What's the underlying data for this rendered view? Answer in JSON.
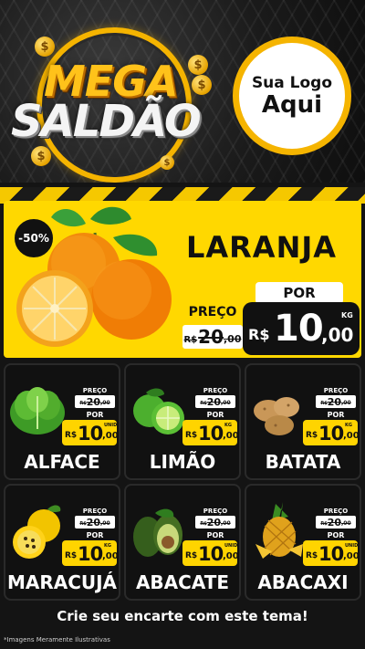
{
  "header": {
    "title_line1": "MEGA",
    "title_line2": "SALDÃO",
    "coin_symbol": "$",
    "logo_line1": "Sua Logo",
    "logo_line2": "Aqui",
    "accent_color": "#f5b400"
  },
  "featured": {
    "discount": "-50%",
    "name": "LARANJA",
    "preco_label": "PREÇO",
    "old_price": {
      "currency": "R$",
      "integer": "20",
      "cents": ",00"
    },
    "por_label": "POR",
    "new_price": {
      "currency": "R$",
      "integer": "10",
      "cents": ",00",
      "unit": "KG"
    },
    "icon": "orange-fruit-icon",
    "background_color": "#ffd800"
  },
  "products": [
    {
      "name": "ALFACE",
      "icon": "lettuce-icon",
      "preco_label": "PREÇO",
      "old_price": {
        "currency": "R$",
        "integer": "20",
        "cents": ",00"
      },
      "por_label": "POR",
      "new_price": {
        "currency": "R$",
        "integer": "10",
        "cents": ",00",
        "unit": "UNID"
      }
    },
    {
      "name": "LIMÃO",
      "icon": "lime-icon",
      "preco_label": "PREÇO",
      "old_price": {
        "currency": "R$",
        "integer": "20",
        "cents": ",00"
      },
      "por_label": "POR",
      "new_price": {
        "currency": "R$",
        "integer": "10",
        "cents": ",00",
        "unit": "KG"
      }
    },
    {
      "name": "BATATA",
      "icon": "potato-icon",
      "preco_label": "PREÇO",
      "old_price": {
        "currency": "R$",
        "integer": "20",
        "cents": ",00"
      },
      "por_label": "POR",
      "new_price": {
        "currency": "R$",
        "integer": "10",
        "cents": ",00",
        "unit": "KG"
      }
    },
    {
      "name": "MARACUJÁ",
      "icon": "passion-fruit-icon",
      "preco_label": "PREÇO",
      "old_price": {
        "currency": "R$",
        "integer": "20",
        "cents": ",00"
      },
      "por_label": "POR",
      "new_price": {
        "currency": "R$",
        "integer": "10",
        "cents": ",00",
        "unit": "KG"
      }
    },
    {
      "name": "ABACATE",
      "icon": "avocado-icon",
      "preco_label": "PREÇO",
      "old_price": {
        "currency": "R$",
        "integer": "20",
        "cents": ",00"
      },
      "por_label": "POR",
      "new_price": {
        "currency": "R$",
        "integer": "10",
        "cents": ",00",
        "unit": "UNID"
      }
    },
    {
      "name": "ABACAXI",
      "icon": "pineapple-icon",
      "preco_label": "PREÇO",
      "old_price": {
        "currency": "R$",
        "integer": "20",
        "cents": ",00"
      },
      "por_label": "POR",
      "new_price": {
        "currency": "R$",
        "integer": "10",
        "cents": ",00",
        "unit": "UNID"
      }
    }
  ],
  "footer": {
    "cta": "Crie seu encarte com este tema!",
    "note": "*Imagens Meramente Ilustrativas"
  }
}
